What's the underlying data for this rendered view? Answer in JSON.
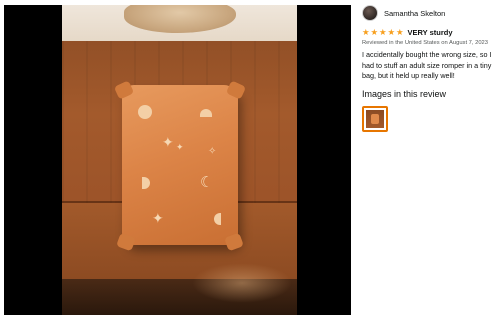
{
  "review": {
    "reviewer_name": "Samantha Skelton",
    "rating": 5,
    "rating_max": 5,
    "headline": "VERY sturdy",
    "meta": "Reviewed in the United States on August 7, 2023",
    "body": "I accidentally bought the wrong size, so I had to stuff an adult size romper in a tiny bag, but it held up really well!",
    "images_heading": "Images in this review"
  },
  "colors": {
    "star": "#f79f1e",
    "thumbnail_selected_border": "#e77600",
    "viewer_background": "#000000"
  },
  "icons": {
    "star": "star-icon",
    "avatar": "avatar"
  }
}
